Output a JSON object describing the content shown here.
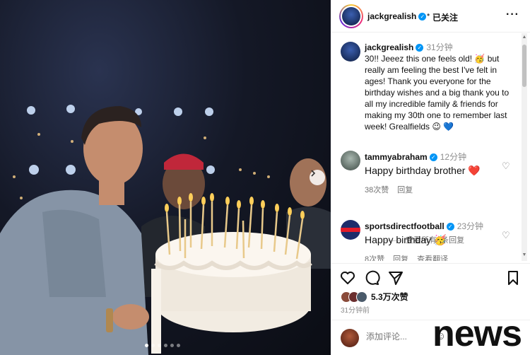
{
  "post": {
    "username": "jackgrealish",
    "follow_status": "已关注",
    "more_icon": "more-horizontal-icon",
    "caption_time": "31分钟",
    "caption_text": "30!! Jeeez this one feels old! 🥳 but really am feeling the best I've felt in ages! Thank you everyone for the birthday wishes and a big thank you to all my incredible family & friends for making my 30th one to remember last week! Grealfields 😉 💙",
    "carousel": {
      "dots": 6,
      "active": 0,
      "next_icon": "chevron-right-icon"
    }
  },
  "comments": [
    {
      "username": "tammyabraham",
      "time": "12分钟",
      "text": "Happy birthday brother",
      "emoji": "❤️",
      "likes": "38次赞",
      "reply": "回复",
      "view_replies": "查看所有1条回复"
    },
    {
      "username": "sportsdirectfootball",
      "time": "23分钟",
      "text": "Happy birthday",
      "emoji": "🥳",
      "likes": "8次赞",
      "reply": "回复",
      "translate": "查看翻译"
    }
  ],
  "actions": {
    "icons": [
      "heart-icon",
      "comment-icon",
      "share-icon",
      "bookmark-icon"
    ],
    "likes_count": "5.3万次赞",
    "posted_ago": "31分钟前"
  },
  "comment_box": {
    "placeholder": "添加评论...",
    "emoji_icon": "smile-icon"
  },
  "watermark": "news",
  "colors": {
    "verified": "#0095f6",
    "meta_grey": "#8e8e8e",
    "heart_red": "#ed1c24"
  }
}
